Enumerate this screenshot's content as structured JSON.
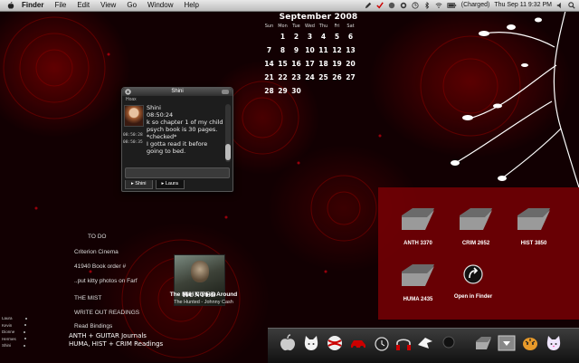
{
  "menubar": {
    "app_name": "Finder",
    "menus": [
      "File",
      "Edit",
      "View",
      "Go",
      "Window",
      "Help"
    ],
    "battery_status": "(Charged)",
    "clock": "Thu Sep 11  9:32 PM"
  },
  "calendar": {
    "title": "September 2008",
    "weekdays": [
      "Sun",
      "Mon",
      "Tue",
      "Wed",
      "Thu",
      "Fri",
      "Sat"
    ],
    "days": [
      "",
      "1",
      "2",
      "3",
      "4",
      "5",
      "6",
      "7",
      "8",
      "9",
      "10",
      "11",
      "12",
      "13",
      "14",
      "15",
      "16",
      "17",
      "18",
      "19",
      "20",
      "21",
      "22",
      "23",
      "24",
      "25",
      "26",
      "27",
      "28",
      "29",
      "30",
      "",
      "",
      "",
      ""
    ],
    "today": "11"
  },
  "chat": {
    "title": "Shini",
    "subtitle": "Hoax",
    "messages": [
      {
        "text": "Shini"
      },
      {
        "text": "08:50:24"
      },
      {
        "text": "k so chapter 1 of my child psych book is 30 pages."
      },
      {
        "text": "*checked*",
        "time": "08:50:28"
      },
      {
        "text": "I gotta read it before going to bed.",
        "time": "08:50:35"
      }
    ],
    "tabs": [
      "Shini",
      "Laura"
    ]
  },
  "todo": {
    "heading": "TO DO",
    "items": [
      "Criterion Cinema",
      "41940 Book order #",
      "..put kitty photos on Farf",
      "THE MIST",
      "WRITE OUT READINGS",
      "Read Bindings"
    ]
  },
  "handwritten_note": [
    "ANTH + GUITAR Journals",
    "HUMA, HIST + CRIM Readings"
  ],
  "buddy_list": [
    "Laura",
    "Kevin",
    "Dionne",
    "Hermes",
    "Shini"
  ],
  "now_playing": {
    "album_title": "HUNTED",
    "song": "The Man Comes Around",
    "detail": "The Hunted - Johnny Cash"
  },
  "folders": [
    {
      "label": "ANTH 3370"
    },
    {
      "label": "CRIM 2652"
    },
    {
      "label": "HIST 3850"
    },
    {
      "label": "HUMA 2435"
    }
  ],
  "open_in_finder": "Open in Finder",
  "dock": {
    "items": [
      "apple-icon",
      "cat-icon",
      "ball-icon",
      "car-icon",
      "alarm-icon",
      "headphones-icon",
      "bird-icon",
      "chat-bubble-icon",
      "folder-icon",
      "stack-icon",
      "tiger-icon",
      "cat-face-icon"
    ]
  },
  "colors": {
    "accent": "#8a0008",
    "panel": "#780005"
  }
}
